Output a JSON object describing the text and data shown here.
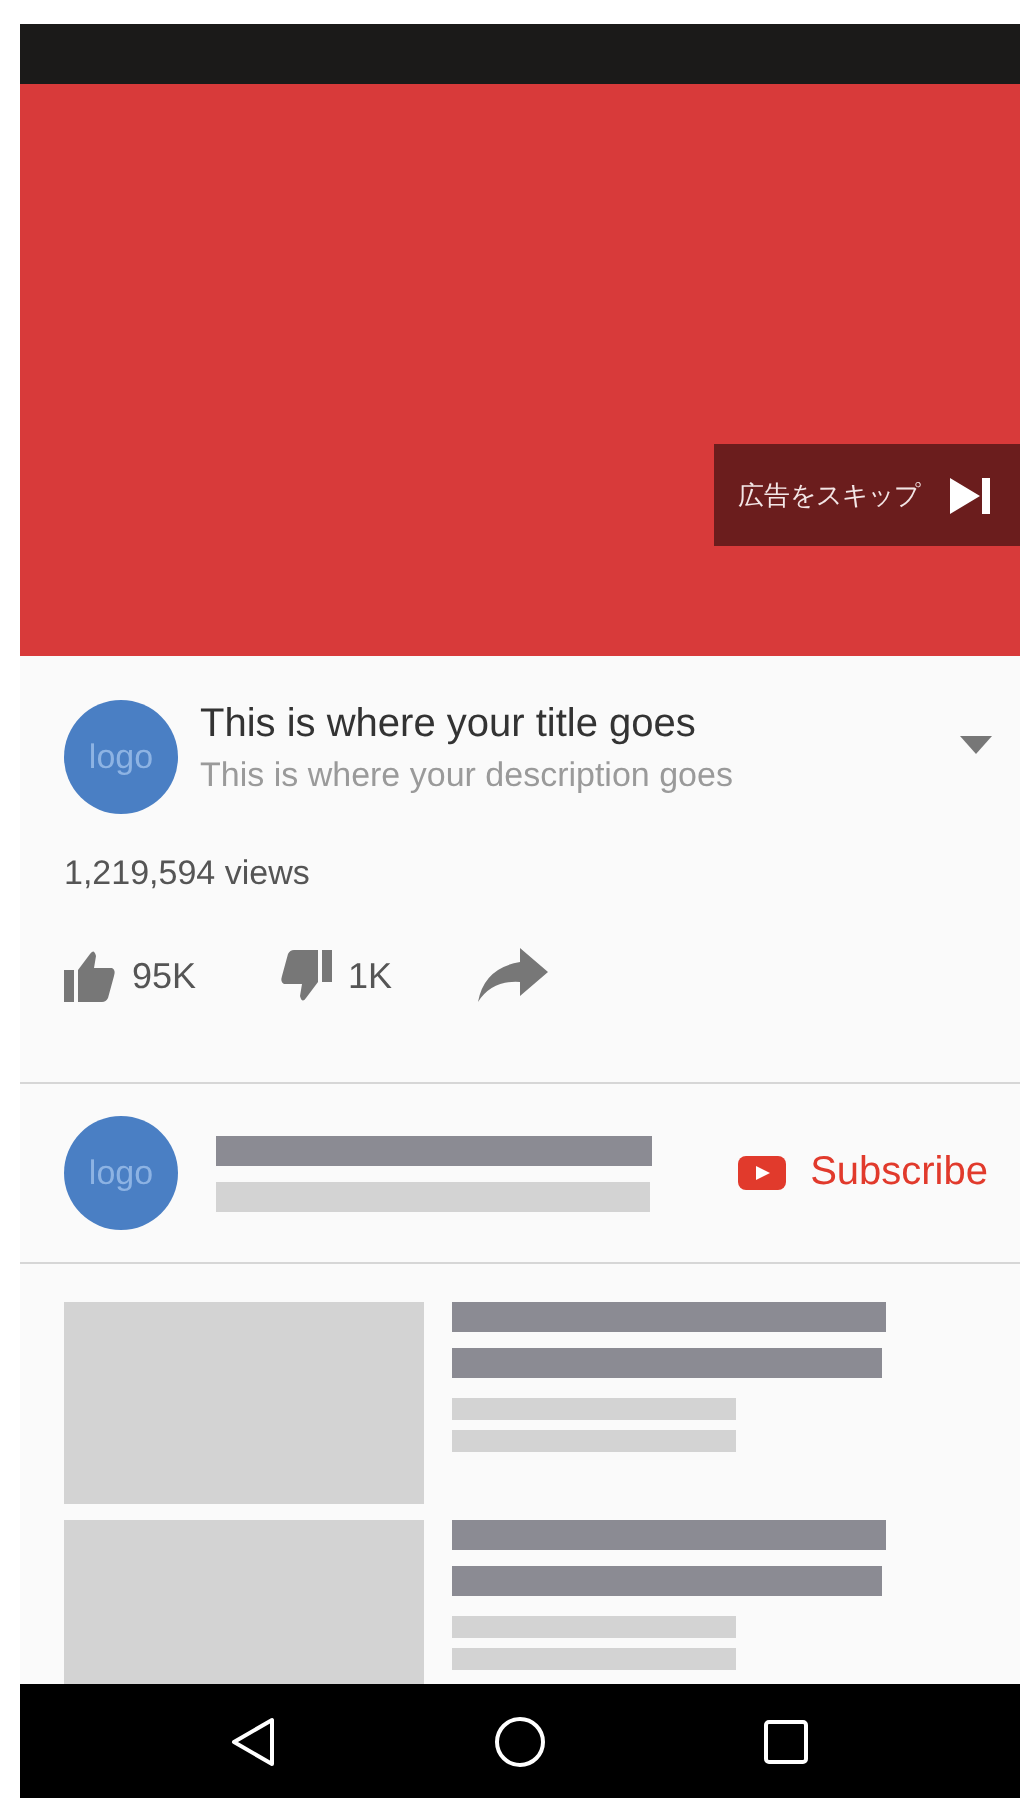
{
  "video": {
    "skip_button": {
      "label": "広告をスキップ"
    }
  },
  "info": {
    "logo": "logo",
    "title": "This is where your title goes",
    "description": "This is where your description goes",
    "views": "1,219,594 views",
    "likes": "95K",
    "dislikes": "1K"
  },
  "channel": {
    "logo": "logo",
    "subscribe": "Subscribe"
  },
  "recommendations": [
    {
      "kind": "video-placeholder"
    },
    {
      "kind": "video-placeholder"
    }
  ]
}
